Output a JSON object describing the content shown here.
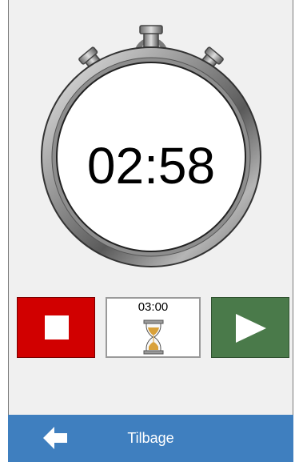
{
  "stopwatch": {
    "time": "02:58"
  },
  "controls": {
    "stop": {
      "icon": "stop-icon",
      "color": "#d10000"
    },
    "preset": {
      "time": "03:00",
      "icon": "hourglass-icon"
    },
    "play": {
      "icon": "play-icon",
      "color": "#4a7a4a"
    }
  },
  "footer": {
    "back_label": "Tilbage",
    "icon": "arrow-left-icon",
    "color": "#3f7fbf"
  }
}
